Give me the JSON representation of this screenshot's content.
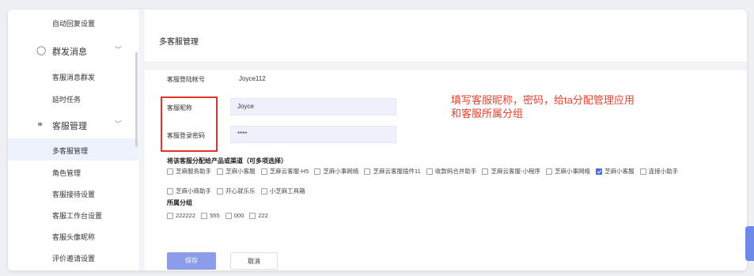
{
  "sidebar": {
    "items": [
      {
        "label": "自动回复设置"
      },
      {
        "label": "群发消息",
        "group": true,
        "icon": "users-icon"
      },
      {
        "label": "客服消息群发"
      },
      {
        "label": "延时任务"
      },
      {
        "label": "客服管理",
        "group": true,
        "icon": "headset-icon"
      },
      {
        "label": "多客服管理",
        "active": true
      },
      {
        "label": "角色管理"
      },
      {
        "label": "客服接待设置"
      },
      {
        "label": "客服工作台设置"
      },
      {
        "label": "客服头像昵称"
      },
      {
        "label": "评价邀请设置"
      }
    ],
    "chevron": "﹀"
  },
  "header": {
    "title": "多客服管理"
  },
  "form": {
    "login_account_label": "客服登陆帐号",
    "login_account_value": "Joyce112",
    "nickname_label": "客服昵称",
    "nickname_value": "Joyce",
    "password_label": "客服登录密码",
    "password_value": "****",
    "channels_label": "将该客服分配给产品或渠道（可多项选择）",
    "channels": [
      {
        "label": "芝麻服务助手",
        "checked": false
      },
      {
        "label": "芝麻小客服",
        "checked": false
      },
      {
        "label": "芝麻云客服-H5",
        "checked": false
      },
      {
        "label": "芝麻小事网络",
        "checked": false
      },
      {
        "label": "芝麻云客服插件11",
        "checked": false
      },
      {
        "label": "收款码合并助手",
        "checked": false
      },
      {
        "label": "芝麻云客服-小程序",
        "checked": false
      },
      {
        "label": "芝麻小事网络",
        "checked": false
      },
      {
        "label": "芝麻小客服",
        "checked": true
      },
      {
        "label": "连接小助手",
        "checked": false
      },
      {
        "label": "芝麻小商助手",
        "checked": false
      },
      {
        "label": "开心就乐乐",
        "checked": false
      },
      {
        "label": "小芝麻工具箱",
        "checked": false
      }
    ],
    "groups_label": "所属分组",
    "groups": [
      {
        "label": "222222",
        "checked": false
      },
      {
        "label": "555",
        "checked": false
      },
      {
        "label": "000",
        "checked": false
      },
      {
        "label": "222",
        "checked": false
      }
    ],
    "save_label": "保存",
    "cancel_label": "取消"
  },
  "annotation": {
    "line1": "填写客服昵称，密码，给ta分配管理应用",
    "line2": "和客服所属分组"
  },
  "colors": {
    "accent": "#4a6ee0",
    "annotation": "#e8412f",
    "highlight_border": "#e0332a",
    "save_button": "#8c9bea"
  }
}
